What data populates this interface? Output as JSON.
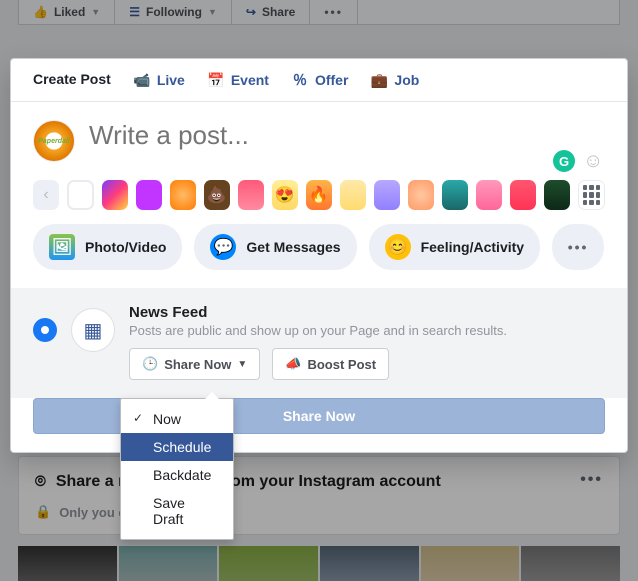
{
  "topbar": {
    "liked": "Liked",
    "following": "Following",
    "share": "Share"
  },
  "tabs": {
    "create_post": "Create Post",
    "live": "Live",
    "event": "Event",
    "offer": "Offer",
    "job": "Job"
  },
  "compose": {
    "placeholder": "Write a post...",
    "avatar_label": "Paperdali"
  },
  "attach": {
    "photo_video": "Photo/Video",
    "get_messages": "Get Messages",
    "feeling_activity": "Feeling/Activity"
  },
  "feed": {
    "title": "News Feed",
    "subtitle": "Posts are public and show up on your Page and in search results.",
    "share_now_btn": "Share Now",
    "boost_post_btn": "Boost Post"
  },
  "primary_action": "Share Now",
  "dropdown": {
    "now": "Now",
    "schedule": "Schedule",
    "backdate": "Backdate",
    "save_draft": "Save Draft"
  },
  "instagram": {
    "heading": "Share a recent photo from your Instagram account",
    "only_you": "Only you can see this"
  }
}
